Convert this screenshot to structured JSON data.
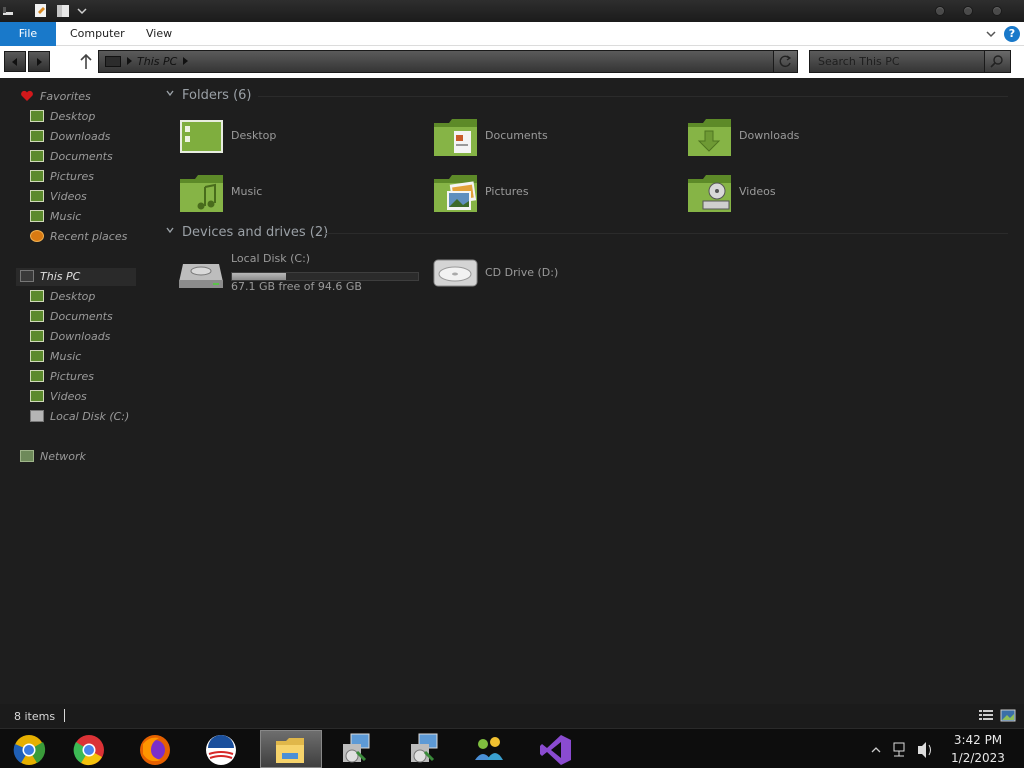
{
  "ribbon": {
    "file_label": "File",
    "tabs": [
      "Computer",
      "View"
    ]
  },
  "navigation": {
    "address_path": [
      "This PC"
    ],
    "search_placeholder": "Search This PC"
  },
  "sidebar": {
    "favorites": {
      "label": "Favorites",
      "items": [
        "Desktop",
        "Downloads",
        "Documents",
        "Pictures",
        "Videos",
        "Music",
        "Recent places"
      ]
    },
    "this_pc": {
      "label": "This PC",
      "items": [
        "Desktop",
        "Documents",
        "Downloads",
        "Music",
        "Pictures",
        "Videos",
        "Local Disk (C:)"
      ]
    },
    "network": {
      "label": "Network"
    }
  },
  "content": {
    "folders_header": "Folders (6)",
    "folders": [
      "Desktop",
      "Documents",
      "Downloads",
      "Music",
      "Pictures",
      "Videos"
    ],
    "drives_header": "Devices and drives (2)",
    "drives": [
      {
        "name": "Local Disk (C:)",
        "free_text": "67.1 GB free of 94.6 GB",
        "used_fraction": 0.29
      },
      {
        "name": "CD Drive (D:)"
      }
    ]
  },
  "status": {
    "item_count": "8 items"
  },
  "taskbar": {
    "apps": [
      "chrome-canary",
      "chrome",
      "firefox",
      "obama-logo",
      "file-explorer",
      "setup-installer",
      "setup-installer",
      "people-app",
      "visual-studio"
    ],
    "time": "3:42 PM",
    "date": "1/2/2023"
  },
  "colors": {
    "accent": "#1979ca",
    "folder_green": "#7fae3e",
    "background": "#1e1e1e"
  }
}
